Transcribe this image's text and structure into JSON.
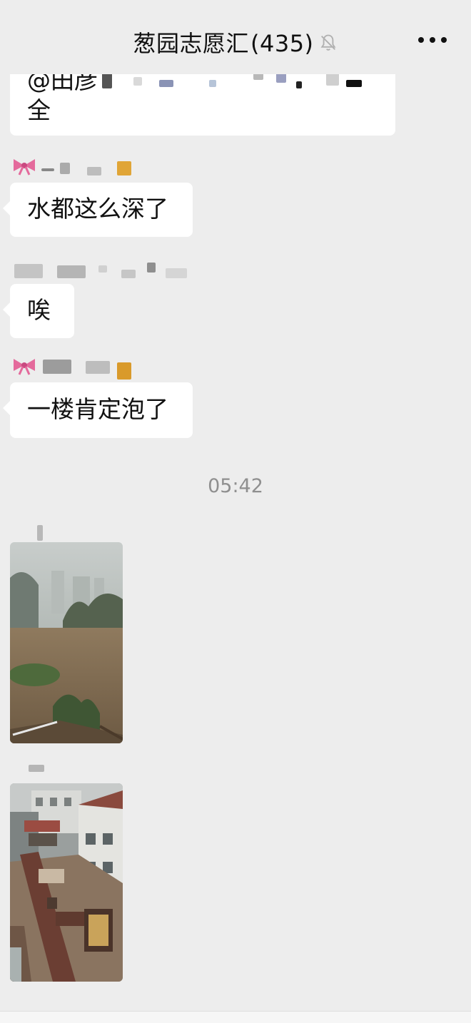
{
  "header": {
    "title": "葱园志愿汇",
    "member_count": "(435)",
    "mute_icon": "bell-muted-icon",
    "more_icon": "more-dots-icon"
  },
  "messages": [
    {
      "text_line1": "@田彦",
      "text_line2": "全"
    },
    {
      "text": "水都这么深了"
    },
    {
      "text": "唉"
    },
    {
      "text": "一楼肯定泡了"
    }
  ],
  "timestamp": "05:42",
  "colors": {
    "background": "#ededed",
    "bubble": "#ffffff",
    "bow": "#e46a9c",
    "badge": "#e0a537"
  }
}
